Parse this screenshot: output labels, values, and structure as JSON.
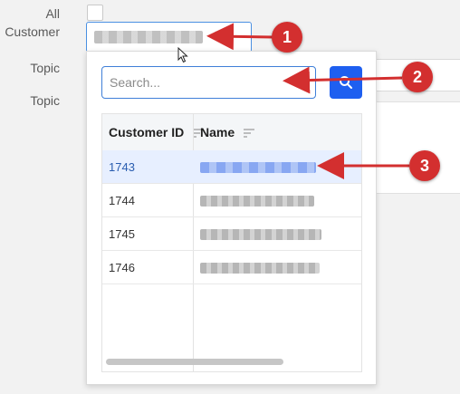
{
  "form": {
    "all_label": "All",
    "customer_label": "Customer",
    "topic_label_1": "Topic",
    "topic_label_2": "Topic",
    "clear_glyph": "×"
  },
  "dropdown": {
    "search_placeholder": "Search...",
    "search_icon": "search-icon",
    "columns": [
      "Customer ID",
      "Name"
    ],
    "rows": [
      {
        "id": "1743",
        "selected": true
      },
      {
        "id": "1744",
        "selected": false
      },
      {
        "id": "1745",
        "selected": false
      },
      {
        "id": "1746",
        "selected": false
      }
    ]
  },
  "annotations": [
    "1",
    "2",
    "3"
  ],
  "colors": {
    "accent": "#1e5ff0",
    "selected_row": "#e7efff",
    "callout": "#d32f2f"
  }
}
